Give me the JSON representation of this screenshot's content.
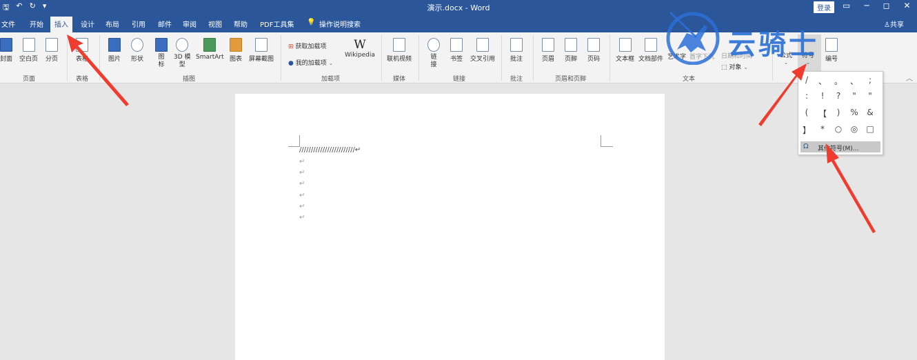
{
  "window": {
    "title": "演示.docx - Word",
    "login_label": "登录",
    "qat_save": "🖫",
    "qat_undo": "↶",
    "qat_redo": "↻",
    "qat_more": "▾",
    "restore": "▭",
    "minimize": "─",
    "maximize": "◻",
    "close": "✕"
  },
  "tabs": [
    {
      "label": "文件"
    },
    {
      "label": "开始"
    },
    {
      "label": "插入"
    },
    {
      "label": "设计"
    },
    {
      "label": "布局"
    },
    {
      "label": "引用"
    },
    {
      "label": "邮件"
    },
    {
      "label": "审阅"
    },
    {
      "label": "视图"
    },
    {
      "label": "帮助"
    },
    {
      "label": "PDF工具集"
    },
    {
      "label": "操作说明搜索"
    }
  ],
  "share_label": "共享",
  "ribbon": {
    "buttons": {
      "cover": "封面",
      "blank": "空白页",
      "pagebreak": "分页",
      "table": "表格",
      "picture": "图片",
      "shapes": "形状",
      "icons_1": "图",
      "icons_2": "标",
      "model3d_1": "3D 模",
      "model3d_2": "型",
      "smartart": "SmartArt",
      "chart": "图表",
      "screenshot": "屏幕截图",
      "get_addins": "获取加载项",
      "my_addins": "我的加载项",
      "wikipedia_logo": "W",
      "wikipedia": "Wikipedia",
      "online_video": "联机视频",
      "link_1": "链",
      "link_2": "接",
      "bookmark": "书签",
      "crossref": "交叉引用",
      "comment": "批注",
      "header": "页眉",
      "footer": "页脚",
      "pagenum": "页码",
      "textbox": "文本框",
      "docparts": "文档部件",
      "wordart": "艺术字",
      "dropcap": "首字下沉",
      "datetime": "日期和时间",
      "object": "对象",
      "equation": "公式",
      "symbol": "符号",
      "number": "编号"
    },
    "groups": {
      "pages": "页面",
      "tables": "表格",
      "illustrations": "插图",
      "addins": "加载项",
      "media": "媒体",
      "links": "链接",
      "comments": "批注",
      "headerfooter": "页眉和页脚",
      "text": "文本"
    }
  },
  "document": {
    "line1": "////////////////////////↵",
    "para_mark": "↵"
  },
  "symbol_dropdown": {
    "row1": [
      "/",
      "、",
      "。",
      "、",
      ";"
    ],
    "row2": [
      ":",
      "!",
      "?",
      "\"",
      "\""
    ],
    "row3": [
      "(",
      "【",
      ")",
      "%",
      "&"
    ],
    "row4": [
      "】",
      "*",
      "○",
      "◎",
      "□"
    ],
    "more_symbols": "其他符号(M)...",
    "omega": "Ω"
  },
  "watermark": {
    "text": "云骑士"
  },
  "colors": {
    "word_blue": "#2b579a",
    "arrow_red": "#f03c2e"
  }
}
